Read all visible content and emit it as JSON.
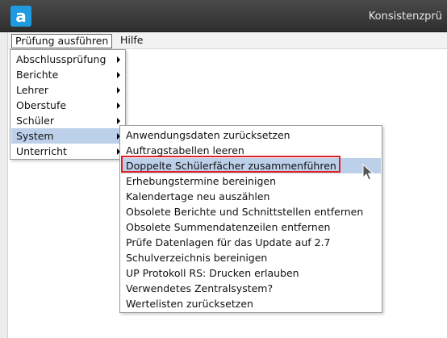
{
  "window": {
    "title": "Konsistenzprü",
    "logo_letter": "a",
    "colors": {
      "titlebar": "#2e2e2e",
      "logo": "#1e9be0",
      "highlight_border": "#e02020",
      "active_item": "#bcd0ea"
    }
  },
  "menubar": {
    "items": [
      {
        "label": "Prüfung ausführen"
      },
      {
        "label": "Hilfe"
      }
    ]
  },
  "main_menu": {
    "items": [
      {
        "label": "Abschlussprüfung",
        "has_submenu": true
      },
      {
        "label": "Berichte",
        "has_submenu": true
      },
      {
        "label": "Lehrer",
        "has_submenu": true
      },
      {
        "label": "Oberstufe",
        "has_submenu": true
      },
      {
        "label": "Schüler",
        "has_submenu": true
      },
      {
        "label": "System",
        "has_submenu": true,
        "active": true
      },
      {
        "label": "Unterricht",
        "has_submenu": true
      }
    ]
  },
  "system_submenu": {
    "items": [
      {
        "label": "Anwendungsdaten zurücksetzen"
      },
      {
        "label": "Auftragstabellen leeren"
      },
      {
        "label": "Doppelte Schülerfächer zusammenführen",
        "active": true
      },
      {
        "label": "Erhebungstermine bereinigen"
      },
      {
        "label": "Kalendertage neu auszählen"
      },
      {
        "label": "Obsolete Berichte und Schnittstellen entfernen"
      },
      {
        "label": "Obsolete Summendatenzeilen entfernen"
      },
      {
        "label": "Prüfe Datenlagen für das Update auf 2.7"
      },
      {
        "label": "Schulverzeichnis bereinigen"
      },
      {
        "label": "UP Protokoll RS: Drucken erlauben"
      },
      {
        "label": "Verwendetes Zentralsystem?"
      },
      {
        "label": "Wertelisten zurücksetzen"
      }
    ]
  },
  "icons": {
    "logo": "app-logo-icon",
    "submenu_arrow": "chevron-right-icon",
    "cursor": "mouse-pointer-icon"
  }
}
